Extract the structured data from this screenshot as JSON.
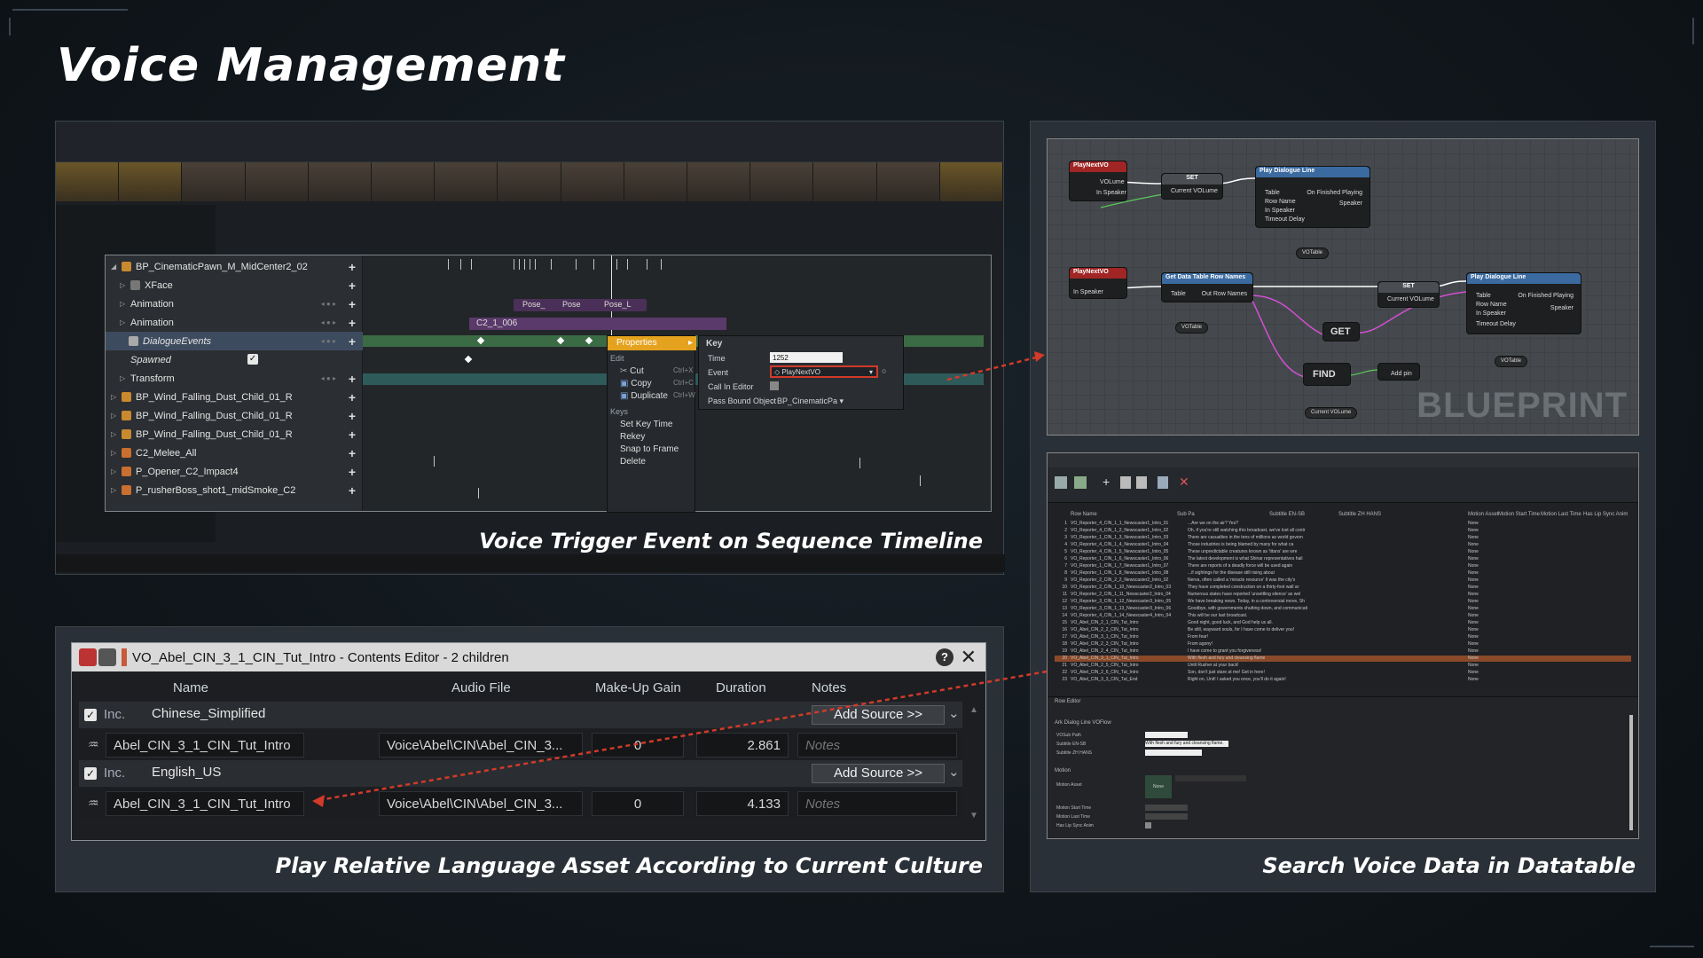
{
  "page": {
    "title": "Voice Management"
  },
  "captions": {
    "sequencer": "Voice Trigger Event on Sequence Timeline",
    "contents": "Play Relative Language Asset According to Current Culture",
    "datatable": "Search Voice Data in Datatable"
  },
  "sequencer": {
    "tracks": [
      {
        "label": "BP_CinematicPawn_M_MidCenter2_02",
        "indent": 0
      },
      {
        "label": "XFace",
        "indent": 1
      },
      {
        "label": "Animation",
        "indent": 1
      },
      {
        "label": "Animation",
        "indent": 1
      },
      {
        "label": "DialogueEvents",
        "indent": 1
      },
      {
        "label": "Spawned",
        "indent": 1
      },
      {
        "label": "Transform",
        "indent": 1
      },
      {
        "label": "BP_Wind_Falling_Dust_Child_01_R",
        "indent": 0
      },
      {
        "label": "BP_Wind_Falling_Dust_Child_01_R",
        "indent": 0
      },
      {
        "label": "BP_Wind_Falling_Dust_Child_01_R",
        "indent": 0
      },
      {
        "label": "C2_Melee_All",
        "indent": 0
      },
      {
        "label": "P_Opener_C2_Impact4",
        "indent": 0
      },
      {
        "label": "P_rusherBoss_shot1_midSmoke_C2",
        "indent": 0
      }
    ],
    "clip_label": "C2_1_006",
    "pose_labels": [
      "Pose_",
      "Pose",
      "Pose_L"
    ],
    "context_menu": {
      "properties": "Properties",
      "edit_header": "Edit",
      "cut": "Cut",
      "cut_key": "Ctrl+X",
      "copy": "Copy",
      "copy_key": "Ctrl+C",
      "duplicate": "Duplicate",
      "duplicate_key": "Ctrl+W",
      "keys_header": "Keys",
      "set_key_time": "Set Key Time",
      "rekey": "Rekey",
      "snap_to_frame": "Snap to Frame",
      "delete": "Delete"
    },
    "key_props": {
      "header": "Key",
      "time_label": "Time",
      "time_value": "1252",
      "event_label": "Event",
      "event_value": "PlayNextVO",
      "call_in_editor_label": "Call In Editor",
      "pass_bound_label": "Pass Bound Object",
      "pass_bound_value": "BP_CinematicPa"
    }
  },
  "blueprint": {
    "watermark": "BLUEPRINT",
    "nodes": {
      "play_next_vo_1": "PlayNextVO",
      "play_next_vo_2": "PlayNextVO",
      "set_1": "SET",
      "set_2": "SET",
      "play_dialogue_1": "Play Dialogue Line",
      "play_dialogue_2": "Play Dialogue Line",
      "get_row_names": "Get Data Table Row Names",
      "get": "GET",
      "find": "FIND"
    },
    "pins": {
      "volume": "VOLume",
      "in_speaker": "In Speaker",
      "current_volume": "Current VOLume",
      "table": "Table",
      "row_name": "Row Name",
      "timeout_delay": "Timeout Delay",
      "on_finished": "On Finished Playing",
      "speaker": "Speaker",
      "out_row_names": "Out Row Names",
      "vo_table": "VOTable",
      "add_pin": "Add pin"
    }
  },
  "datatable": {
    "headers": [
      "Row Name",
      "Sub Pa",
      "Subtitle EN-SB",
      "Subtitle ZH HANS",
      "Motion Asset",
      "Motion Start Time",
      "Motion Last Time",
      "Has Lip Sync Anim"
    ],
    "rows": [
      [
        "1",
        "VO_Reporter_4_CIN_1_1_Newscaster1_Intro_01",
        "...Are we on the air? Yes?"
      ],
      [
        "2",
        "VO_Reporter_4_CIN_1_2_Newscaster1_Intro_02",
        "Oh, if you're still watching this broadcast, we've lost all contr"
      ],
      [
        "3",
        "VO_Reporter_1_CIN_1_3_Newscaster1_Intro_03",
        "There are casualties in the tens of millions as world govern"
      ],
      [
        "4",
        "VO_Reporter_4_CIN_1_4_Newscaster1_Intro_04",
        "Those industries is being blamed by many for what ca"
      ],
      [
        "5",
        "VO_Reporter_4_CIN_1_5_Newscaster1_Intro_05",
        "These unpredictable creatures known as 'titans' are wre"
      ],
      [
        "6",
        "VO_Reporter_1_CIN_1_6_Newscaster1_Intro_06",
        "The latest development is what Shinar representatives hail"
      ],
      [
        "7",
        "VO_Reporter_1_CIN_1_7_Newscaster1_Intro_07",
        "There are reports of a deadly force will be used again"
      ],
      [
        "8",
        "VO_Reporter_1_CIN_1_8_Newscaster1_Intro_08",
        "...if sightings for the disease still rising about"
      ],
      [
        "9",
        "VO_Reporter_2_CIN_2_2_Newscaster2_Intro_02",
        "Nerva, often called a 'miracle resource' It was the city's"
      ],
      [
        "10",
        "VO_Reporter_2_CIN_1_10_Newscaster2_Intro_03",
        "They have completed construction on a thirty-foot wall ar"
      ],
      [
        "11",
        "VO_Reporter_2_CIN_1_11_Newscaster2_Intro_04",
        "Numerous states have reported 'unsettling silence' as wel"
      ],
      [
        "12",
        "VO_Reporter_3_CIN_1_12_Newscaster3_Intro_05",
        "We have breaking news. Today, in a controversial move, Sh"
      ],
      [
        "13",
        "VO_Reporter_3_CIN_1_13_Newscaster3_Intro_06",
        "Goodbye, with governments shutting down, and communicati"
      ],
      [
        "14",
        "VO_Reporter_4_CIN_1_14_Newscaster4_Intro_04",
        "This will be our last broadcast."
      ],
      [
        "15",
        "VO_Abel_CIN_2_1_CIN_Tut_Intro",
        "Good night, good luck, and God help us all."
      ],
      [
        "16",
        "VO_Abel_CIN_2_2_CIN_Tut_Intro",
        "Be still, wayward souls, for I have come to deliver you!"
      ],
      [
        "17",
        "VO_Abel_CIN_3_1_CIN_Tut_Intro",
        "From fear!"
      ],
      [
        "18",
        "VO_Abel_CIN_2_3_CIN_Tut_Intro",
        "From agony!"
      ],
      [
        "19",
        "VO_Abel_CIN_2_4_CIN_Tut_Intro",
        "I have come to grant you forgiveness!"
      ],
      [
        "20",
        "VO_Abel_CIN_3_1_CIN_Tut_Intro",
        "With flesh and fury and cleansing flame"
      ],
      [
        "21",
        "VO_Abel_CIN_2_5_CIN_Tut_Intro",
        "Until Rusher at your back!"
      ],
      [
        "22",
        "VO_Abel_CIN_2_6_CIN_Tut_Intro",
        "Son, don't just stare at me! Get in here!"
      ],
      [
        "23",
        "VO_Abel_CIN_3_3_CIN_Tut_End",
        "Right on, Unit! I asked you once, you'll do it again!"
      ]
    ],
    "row_editor": "Row Editor",
    "section_ark": "Ark Dialog Line VOFlow",
    "section_motion": "Motion",
    "field_labels": [
      "VOSub Path",
      "Subtitle EN-SB",
      "Subtitle ZH HANS",
      "Motion Asset",
      "Motion Start Time",
      "Motion Last Time",
      "Has Lip Sync Anim"
    ],
    "field_value": "With flesh and fury and cleansing flame.",
    "motion_none": "None"
  },
  "contents_editor": {
    "title": "VO_Abel_CIN_3_1_CIN_Tut_Intro - Contents Editor - 2 children",
    "columns": {
      "name": "Name",
      "audio_file": "Audio File",
      "makeup_gain": "Make-Up Gain",
      "duration": "Duration",
      "notes": "Notes"
    },
    "inc_label": "Inc.",
    "add_source": "Add Source >>",
    "groups": [
      {
        "culture": "Chinese_Simplified",
        "asset": "Abel_CIN_3_1_CIN_Tut_Intro",
        "path": "Voice\\Abel\\CIN\\Abel_CIN_3...",
        "gain": "0",
        "duration": "2.861",
        "notes_placeholder": "Notes"
      },
      {
        "culture": "English_US",
        "asset": "Abel_CIN_3_1_CIN_Tut_Intro",
        "path": "Voice\\Abel\\CIN\\Abel_CIN_3...",
        "gain": "0",
        "duration": "4.133",
        "notes_placeholder": "Notes"
      }
    ]
  },
  "colors": {
    "accent_red": "#d23a2a",
    "track_green": "#3b6b44",
    "clip_purple": "#5a3a6a",
    "selection_blue": "#3d4b5e"
  }
}
